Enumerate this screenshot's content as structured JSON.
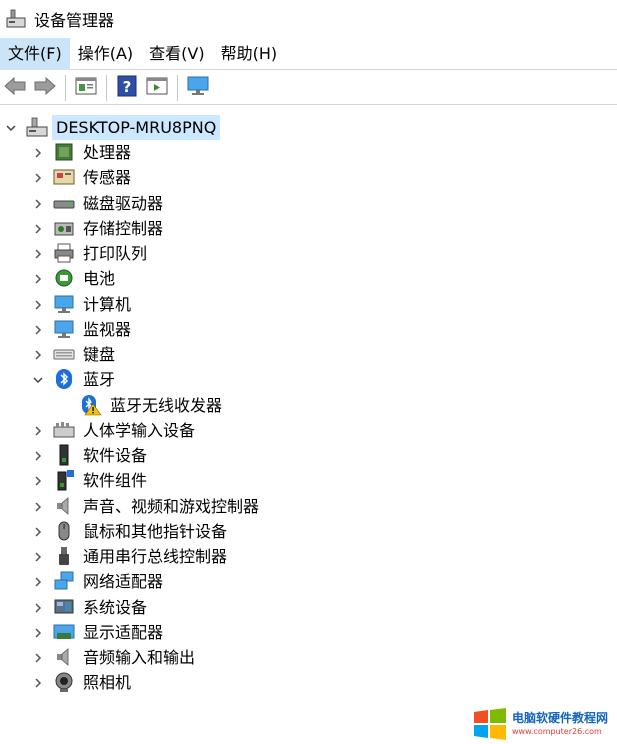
{
  "window": {
    "title": "设备管理器"
  },
  "menu": [
    "文件(F)",
    "操作(A)",
    "查看(V)",
    "帮助(H)"
  ],
  "toolbar": {
    "buttons": [
      "back-arrow-icon",
      "forward-arrow-icon",
      "properties-icon",
      "help-icon",
      "run-icon",
      "monitor-icon"
    ]
  },
  "tree": {
    "root": "DESKTOP-MRU8PNQ",
    "items": [
      {
        "label": "处理器",
        "icon": "processor-icon",
        "expanded": false
      },
      {
        "label": "传感器",
        "icon": "sensor-icon",
        "expanded": false
      },
      {
        "label": "磁盘驱动器",
        "icon": "disk-drive-icon",
        "expanded": false
      },
      {
        "label": "存储控制器",
        "icon": "storage-controller-icon",
        "expanded": false
      },
      {
        "label": "打印队列",
        "icon": "printer-icon",
        "expanded": false
      },
      {
        "label": "电池",
        "icon": "battery-icon",
        "expanded": false
      },
      {
        "label": "计算机",
        "icon": "computer-icon",
        "expanded": false
      },
      {
        "label": "监视器",
        "icon": "monitor-icon",
        "expanded": false
      },
      {
        "label": "键盘",
        "icon": "keyboard-icon",
        "expanded": false
      },
      {
        "label": "蓝牙",
        "icon": "bluetooth-icon",
        "expanded": true
      },
      {
        "label": "蓝牙无线收发器",
        "icon": "bluetooth-warning-icon",
        "child": true
      },
      {
        "label": "人体学输入设备",
        "icon": "hid-icon",
        "expanded": false
      },
      {
        "label": "软件设备",
        "icon": "software-device-icon",
        "expanded": false
      },
      {
        "label": "软件组件",
        "icon": "software-component-icon",
        "expanded": false
      },
      {
        "label": "声音、视频和游戏控制器",
        "icon": "speaker-icon",
        "expanded": false
      },
      {
        "label": "鼠标和其他指针设备",
        "icon": "mouse-icon",
        "expanded": false
      },
      {
        "label": "通用串行总线控制器",
        "icon": "usb-icon",
        "expanded": false
      },
      {
        "label": "网络适配器",
        "icon": "network-icon",
        "expanded": false
      },
      {
        "label": "系统设备",
        "icon": "system-device-icon",
        "expanded": false
      },
      {
        "label": "显示适配器",
        "icon": "display-adapter-icon",
        "expanded": false
      },
      {
        "label": "音频输入和输出",
        "icon": "audio-icon",
        "expanded": false
      },
      {
        "label": "照相机",
        "icon": "camera-icon",
        "expanded": false
      }
    ]
  },
  "watermark": {
    "name": "电脑软硬件教程网",
    "url": "www.computer26.com"
  },
  "colors": {
    "selection": "#cce8ff",
    "menu_active": "#cce4f7",
    "bluetooth": "#1e6fd9"
  }
}
